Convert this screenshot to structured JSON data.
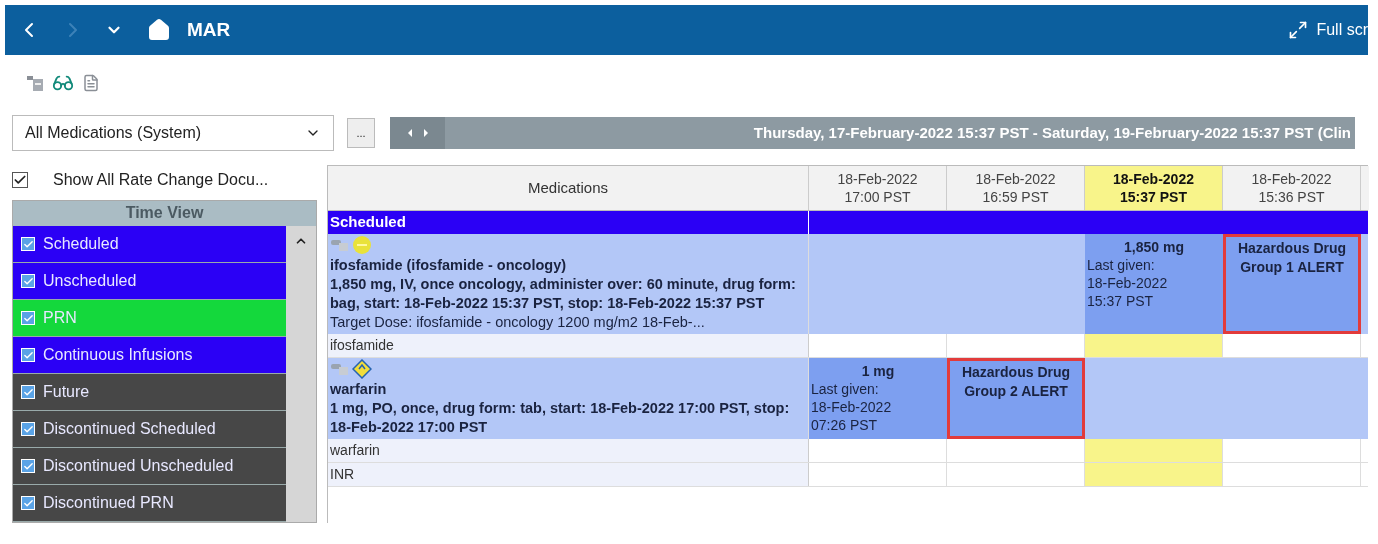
{
  "title_bar": {
    "title": "MAR",
    "full_screen": "Full scr"
  },
  "filter": {
    "value": "All Medications (System)",
    "more": "...",
    "date_range": "Thursday, 17-February-2022 15:37 PST - Saturday, 19-February-2022 15:37 PST (Clin"
  },
  "show_all": {
    "label": "Show All Rate Change Docu...",
    "checked": true
  },
  "time_view": {
    "title": "Time View",
    "items": [
      {
        "label": "Scheduled",
        "checked": true,
        "color": "#2b00f5"
      },
      {
        "label": "Unscheduled",
        "checked": true,
        "color": "#2b00f5"
      },
      {
        "label": "PRN",
        "checked": true,
        "color": "#14d83c"
      },
      {
        "label": "Continuous Infusions",
        "checked": true,
        "color": "#2b00f5"
      },
      {
        "label": "Future",
        "checked": true,
        "color": "#474747"
      },
      {
        "label": "Discontinued Scheduled",
        "checked": true,
        "color": "#474747"
      },
      {
        "label": "Discontinued Unscheduled",
        "checked": true,
        "color": "#474747"
      },
      {
        "label": "Discontinued PRN",
        "checked": true,
        "color": "#474747"
      }
    ]
  },
  "grid": {
    "medications_heading": "Medications",
    "time_columns": [
      {
        "date": "18-Feb-2022",
        "time": "17:00 PST",
        "selected": false
      },
      {
        "date": "18-Feb-2022",
        "time": "16:59 PST",
        "selected": false
      },
      {
        "date": "18-Feb-2022",
        "time": "15:37 PST",
        "selected": true
      },
      {
        "date": "18-Feb-2022",
        "time": "15:36 PST",
        "selected": false
      }
    ],
    "section": "Scheduled",
    "rows": [
      {
        "kind": "order",
        "status_icon": {
          "kind": "circle"
        },
        "name": "ifosfamide (ifosfamide - oncology)",
        "details": "1,850 mg, IV, once oncology, administer over: 60 minute, drug form: bag, start: 18-Feb-2022 15:37 PST, stop: 18-Feb-2022 15:37 PST",
        "target": "Target Dose: ifosfamide - oncology 1200 mg/m2  18-Feb-...",
        "cells": [
          {
            "kind": "empty"
          },
          {
            "kind": "empty"
          },
          {
            "kind": "dose",
            "dose": "1,850 mg",
            "last_given": [
              "Last given:",
              "18-Feb-2022",
              "15:37 PST"
            ]
          },
          {
            "kind": "alert",
            "text": "Hazardous Drug Group 1 ALERT"
          }
        ]
      },
      {
        "kind": "label",
        "name": "ifosfamide"
      },
      {
        "kind": "order",
        "status_icon": {
          "kind": "tag"
        },
        "name": "warfarin",
        "details": "1 mg, PO, once, drug form: tab, start: 18-Feb-2022 17:00 PST, stop: 18-Feb-2022 17:00 PST",
        "cells": [
          {
            "kind": "dose",
            "dose": "1 mg",
            "last_given": [
              "Last given:",
              "18-Feb-2022",
              "07:26 PST"
            ]
          },
          {
            "kind": "alert",
            "text": "Hazardous Drug Group 2 ALERT"
          },
          {
            "kind": "empty"
          },
          {
            "kind": "empty"
          }
        ]
      },
      {
        "kind": "label",
        "name": "warfarin"
      },
      {
        "kind": "label",
        "name": "INR"
      }
    ]
  }
}
